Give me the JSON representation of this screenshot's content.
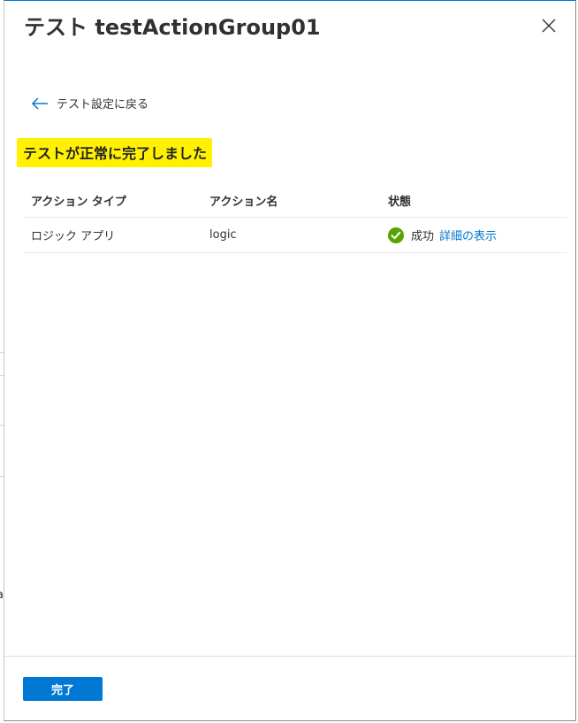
{
  "panel": {
    "title": "テスト testActionGroup01",
    "close_icon": "close-icon"
  },
  "back": {
    "label": "テスト設定に戻る",
    "icon": "arrow-left-icon",
    "color": "#0078d4"
  },
  "result": {
    "heading": "テストが正常に完了しました",
    "highlight_color": "#fff100"
  },
  "table": {
    "headers": [
      "アクション タイプ",
      "アクション名",
      "状態"
    ],
    "rows": [
      {
        "type": "ロジック アプリ",
        "name": "logic",
        "status": "成功",
        "status_icon": "checkmark-circle-icon",
        "status_color": "#57a300",
        "details_link": "詳細の表示"
      }
    ]
  },
  "footer": {
    "done_label": "完了",
    "button_color": "#0078d4"
  },
  "background": {
    "fragments": [
      "(",
      "(",
      "a"
    ]
  }
}
